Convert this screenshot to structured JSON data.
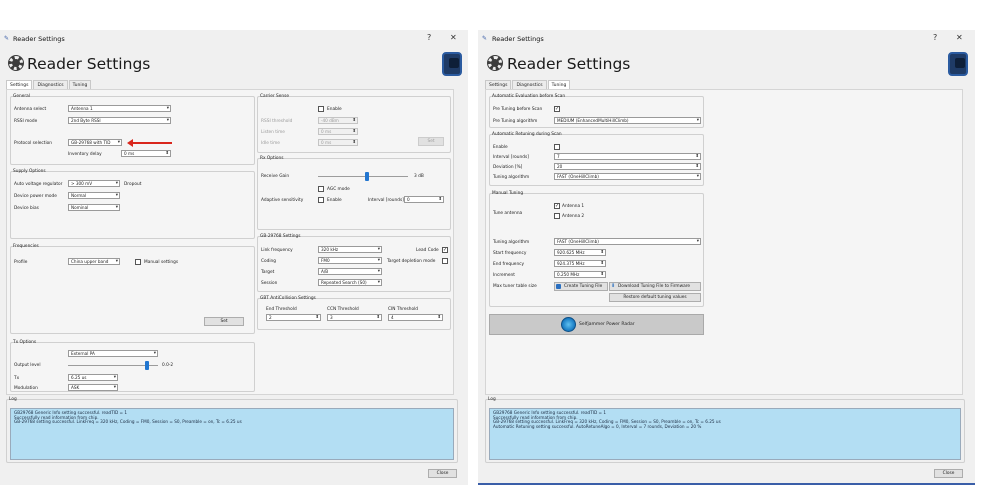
{
  "left": {
    "window_title": "Reader Settings",
    "help": "?",
    "close_x": "✕",
    "header": "Reader Settings",
    "tabs": [
      "Settings",
      "Diagnostics",
      "Tuning"
    ],
    "general": {
      "title": "General",
      "antenna_label": "Antenna select",
      "antenna_value": "Antenna 1",
      "rssi_label": "RSSI mode",
      "rssi_value": "2nd Byte RSSI",
      "protocol_label": "Protocol selection",
      "protocol_value": "GB-29768 with TID",
      "inventory_label": "Inventory delay",
      "inventory_value": "0 ms"
    },
    "supply": {
      "title": "Supply Options",
      "auto_label": "Auto voltage regulator",
      "auto_value": "> 300 mV",
      "dropout": "Dropout",
      "power_label": "Device power mode",
      "power_value": "Normal",
      "bias_label": "Device bias",
      "bias_value": "Nominal"
    },
    "freq": {
      "title": "Frequencies",
      "profile_label": "Profile",
      "profile_value": "China upper band",
      "manual": "Manual settings",
      "set": "Set"
    },
    "tx": {
      "title": "Tx Options",
      "ext_value": "External PA",
      "output_label": "Output level",
      "output_value": "0.0-2",
      "tx_label": "Tx",
      "tx_value": "6.25 us",
      "mod_label": "Modulation",
      "mod_value": "ASK"
    },
    "carrier": {
      "title": "Carrier Sense",
      "enable": "Enable",
      "rssi_th_label": "RSSI threshold",
      "rssi_th_value": "-40 dBm",
      "listen_label": "Listen time",
      "listen_value": "0 ms",
      "idle_label": "Idle time",
      "idle_value": "0 ms",
      "set": "Set"
    },
    "rx": {
      "title": "Rx Options",
      "gain_label": "Receive Gain",
      "gain_value": "3 dB",
      "agc": "AGC mode",
      "adaptive_label": "Adaptive sensitivity",
      "enable": "Enable",
      "interval_label": "Interval [rounds]",
      "interval_value": "0"
    },
    "gb": {
      "title": "GB-29768 Settings",
      "link_label": "Link frequency",
      "link_value": "320 kHz",
      "coding_label": "Coding",
      "coding_value": "FM0",
      "target_label": "Target",
      "target_value": "A/B",
      "session_label": "Session",
      "session_value": "Repeated Search (S0)",
      "lead": "Lead Code",
      "depletion": "Target depletion mode"
    },
    "anticoll": {
      "title": "GBT AntiCollision Settings",
      "end_label": "End Threshold",
      "end_value": "2",
      "ccn_label": "CCN Threshold",
      "ccn_value": "3",
      "cin_label": "CIN Threshold",
      "cin_value": "4"
    },
    "log_title": "Log",
    "log": "GB29768 Generic Info setting successful. readTID = 1\nSuccessfully read information from chip.\nGB-29768 setting successful. LinkFreq = 320 kHz, Coding = FM0, Session = S0, Preamble = on, Tc = 6.25 us",
    "close": "Close"
  },
  "right": {
    "window_title": "Reader Settings",
    "help": "?",
    "close_x": "✕",
    "header": "Reader Settings",
    "tabs": [
      "Settings",
      "Diagnostics",
      "Tuning"
    ],
    "auto_before": {
      "title": "Automatic Evaluation before Scan",
      "pre_label": "Pre Tuning before Scan",
      "algo_label": "Pre Tuning algorithm",
      "algo_value": "MEDIUM (EnhancedMultiHillClimb)"
    },
    "auto_during": {
      "title": "Automatic Retuning during Scan",
      "enable_label": "Enable",
      "interval_label": "Interval [rounds]",
      "interval_value": "7",
      "deviation_label": "Deviation [%]",
      "deviation_value": "20",
      "algo_label": "Tuning algorithm",
      "algo_value": "FAST (OneHillClimb)"
    },
    "manual": {
      "title": "Manual Tuning",
      "ant_label": "Tune antenna",
      "ant1": "Antenna 1",
      "ant2": "Antenna 2",
      "algo_label": "Tuning algorithm",
      "algo_value": "FAST (OneHillClimb)",
      "start_label": "Start frequency",
      "start_value": "920.625 MHz",
      "end_label": "End frequency",
      "end_value": "924.375 MHz",
      "inc_label": "Increment",
      "inc_value": "0.250 MHz",
      "max_label": "Max tuner table size",
      "create": "Create Tuning File",
      "download": "Download Tuning File to Firmware",
      "restore": "Restore default tuning values"
    },
    "radar": "Selfjammer Power Radar",
    "log_title": "Log",
    "log": "GB29768 Generic Info setting successful. readTID = 1\nSuccessfully read information from chip.\nGB-29768 setting successful. LinkFreq = 320 kHz, Coding = FM0, Session = S0, Preamble = on, Tc = 6.25 us\nAutomatic Retuning setting successful. AutoRetuneAlgo = 0, Interval = 7 rounds, Deviation = 20 %",
    "close": "Close"
  }
}
